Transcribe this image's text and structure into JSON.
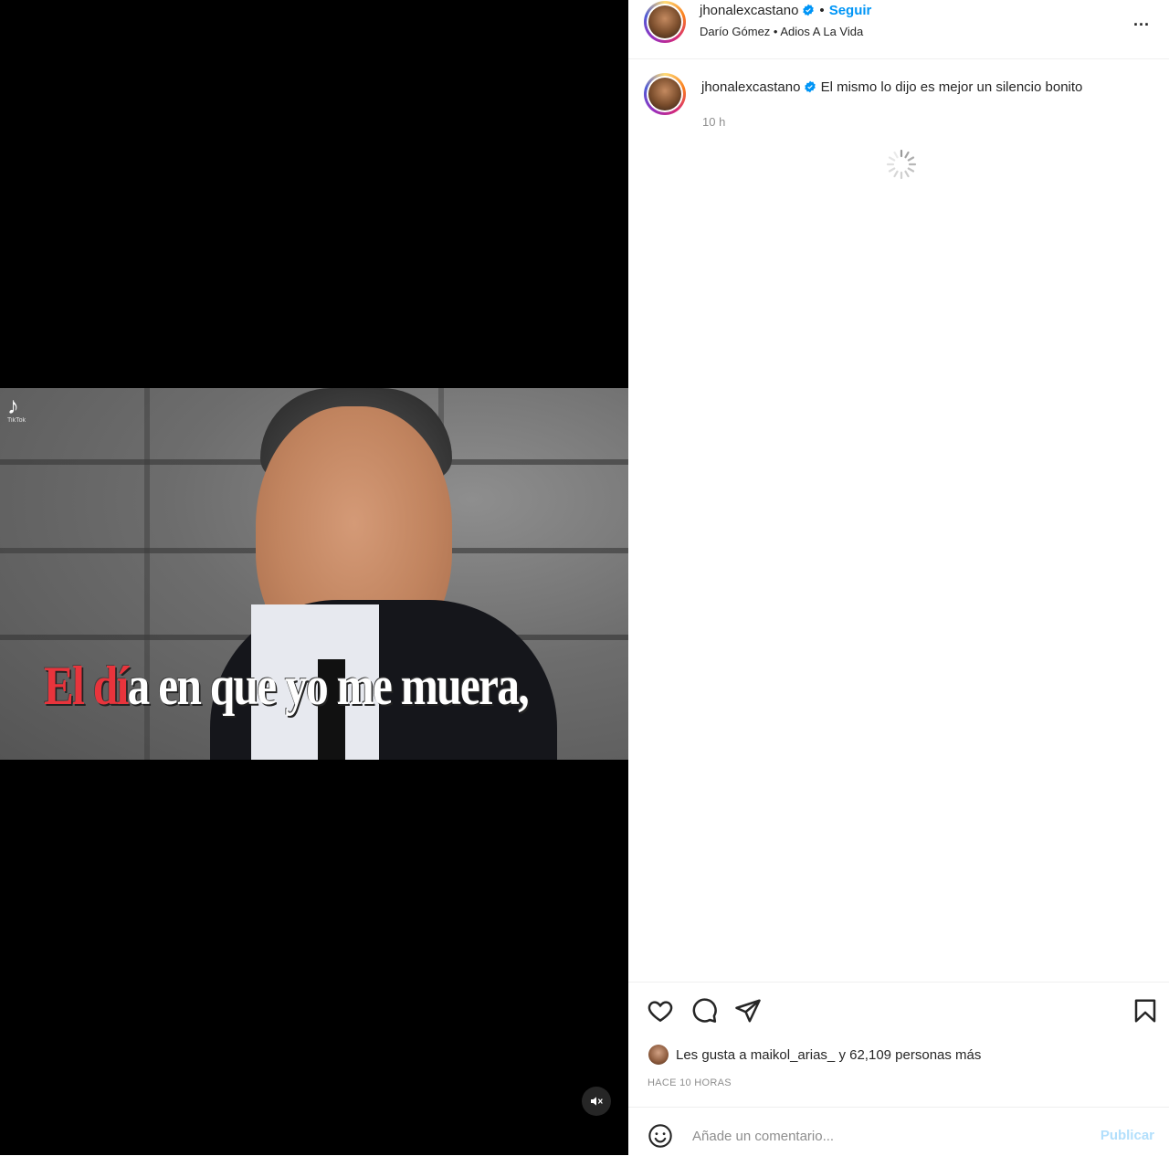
{
  "post": {
    "author": "jhonalexcastano",
    "follow_label": "Seguir",
    "separator": "•",
    "audio": "Darío Gómez • Adios A La Vida",
    "more_label": "...",
    "caption": "El mismo lo dijo es mejor un silencio bonito",
    "caption_time": "10 h",
    "likes_text_prefix": "Les gusta a",
    "likes_user": "maikol_arias_",
    "likes_text_suffix": "y 62,109 personas más",
    "time_ago": "HACE 10 HORAS"
  },
  "video": {
    "overlay_text_highlight": "El dí",
    "overlay_text_rest": "a en que yo me muera,",
    "watermark_brand": "TikTok"
  },
  "comment_box": {
    "placeholder": "Añade un comentario...",
    "publish_label": "Publicar"
  },
  "icons": {
    "verified": "verified-badge-icon",
    "more": "more-options-icon",
    "like": "heart-icon",
    "comment": "comment-bubble-icon",
    "share": "paper-plane-icon",
    "save": "bookmark-icon",
    "emoji": "emoji-smile-icon",
    "mute": "muted-speaker-icon",
    "spinner": "loading-spinner-icon"
  },
  "colors": {
    "accent_blue": "#0095f6",
    "publish_disabled": "#b2dffc",
    "overlay_red": "#e8343c"
  }
}
